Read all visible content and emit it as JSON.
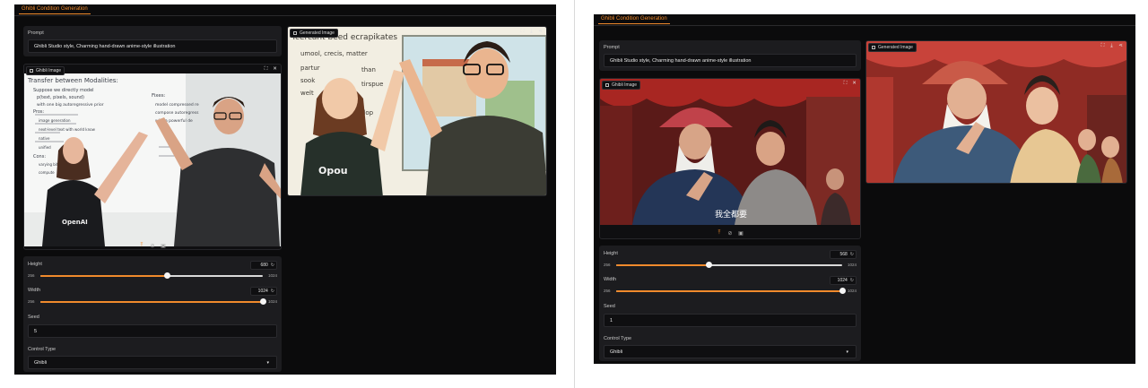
{
  "left": {
    "tab": "Ghibli Condition Generation",
    "prompt_label": "Prompt",
    "prompt_value": "Ghibli Studio style, Charming hand-drawn anime-style illustration",
    "input_image_label": "Ghibli Image",
    "output_image_label": "Generated Image",
    "height_label": "Height",
    "height_value": "680",
    "height_min": "256",
    "height_max": "1024",
    "height_fraction": 0.57,
    "width_label": "Width",
    "width_value": "1024",
    "width_min": "256",
    "width_max": "1024",
    "width_fraction": 1.0,
    "seed_label": "Seed",
    "seed_value": "5",
    "control_type_label": "Control Type",
    "control_type_value": "Ghibli",
    "photo_board_text": [
      "Transfer between Modalities:",
      "Suppose we directly model",
      "p(text, pixels, sound)",
      "with one big autoregressive prior",
      "Pros:",
      "image generation",
      "next-level text with world know",
      "native",
      "unified",
      "Cons:",
      "varying bit-rate",
      "compute",
      "Fixes:",
      "model compressed re",
      "compose autoregress",
      "with a powerful de"
    ],
    "photo_shirt_text": "OpenAI",
    "gen_board_text": [
      "Tcercant beed ecrapikates",
      "umool, crecis, matter",
      "partur",
      "sook",
      "welt",
      "than",
      "tirspue",
      "plop"
    ],
    "gen_shirt_text": "Opou"
  },
  "right": {
    "tab": "Ghibli Condition Generation",
    "prompt_label": "Prompt",
    "prompt_value": "Ghibli Studio style, Charming hand-drawn anime-style illustration",
    "input_image_label": "Ghibli Image",
    "output_image_label": "Generated Image",
    "subtitle": "我全都要",
    "height_label": "Height",
    "height_value": "568",
    "height_min": "256",
    "height_max": "1024",
    "height_fraction": 0.41,
    "width_label": "Width",
    "width_value": "1024",
    "width_min": "256",
    "width_max": "1024",
    "width_fraction": 1.0,
    "seed_label": "Seed",
    "seed_value": "1",
    "control_type_label": "Control Type",
    "control_type_value": "Ghibli"
  },
  "colors": {
    "accent": "#f08a2c",
    "panel": "#1c1c1f",
    "background": "#0b0b0c"
  },
  "icons": [
    "image-icon",
    "fullscreen-icon",
    "close-icon",
    "download-icon",
    "share-icon",
    "upload-icon",
    "clear-icon",
    "clipboard-icon",
    "reset-icon",
    "chevron-down-icon"
  ]
}
